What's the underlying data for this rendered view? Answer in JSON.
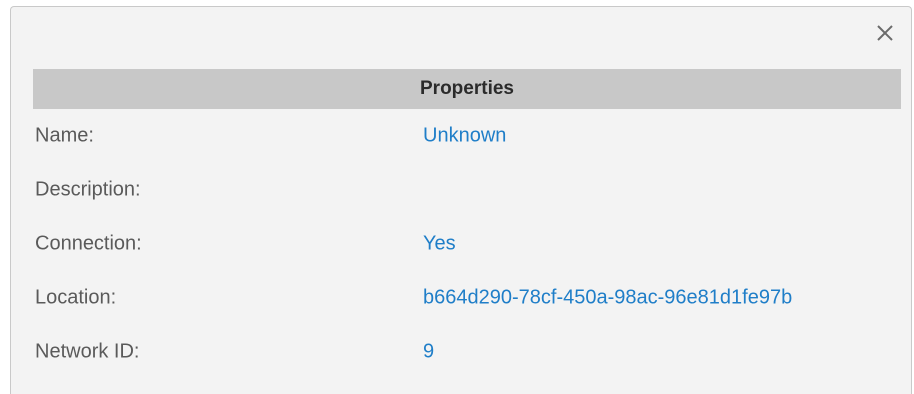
{
  "dialog": {
    "close_label": "×",
    "header_title": "Properties"
  },
  "properties": [
    {
      "label": "Name:",
      "value": "Unknown"
    },
    {
      "label": "Description:",
      "value": ""
    },
    {
      "label": "Connection:",
      "value": "Yes"
    },
    {
      "label": "Location:",
      "value": "b664d290-78cf-450a-98ac-96e81d1fe97b"
    },
    {
      "label": "Network ID:",
      "value": "9"
    }
  ],
  "colors": {
    "panel_bg": "#f3f3f3",
    "header_bg": "#c8c8c8",
    "label_text": "#5a5a5a",
    "value_text": "#1f7ec8"
  },
  "icons": {
    "close": "close-icon"
  }
}
